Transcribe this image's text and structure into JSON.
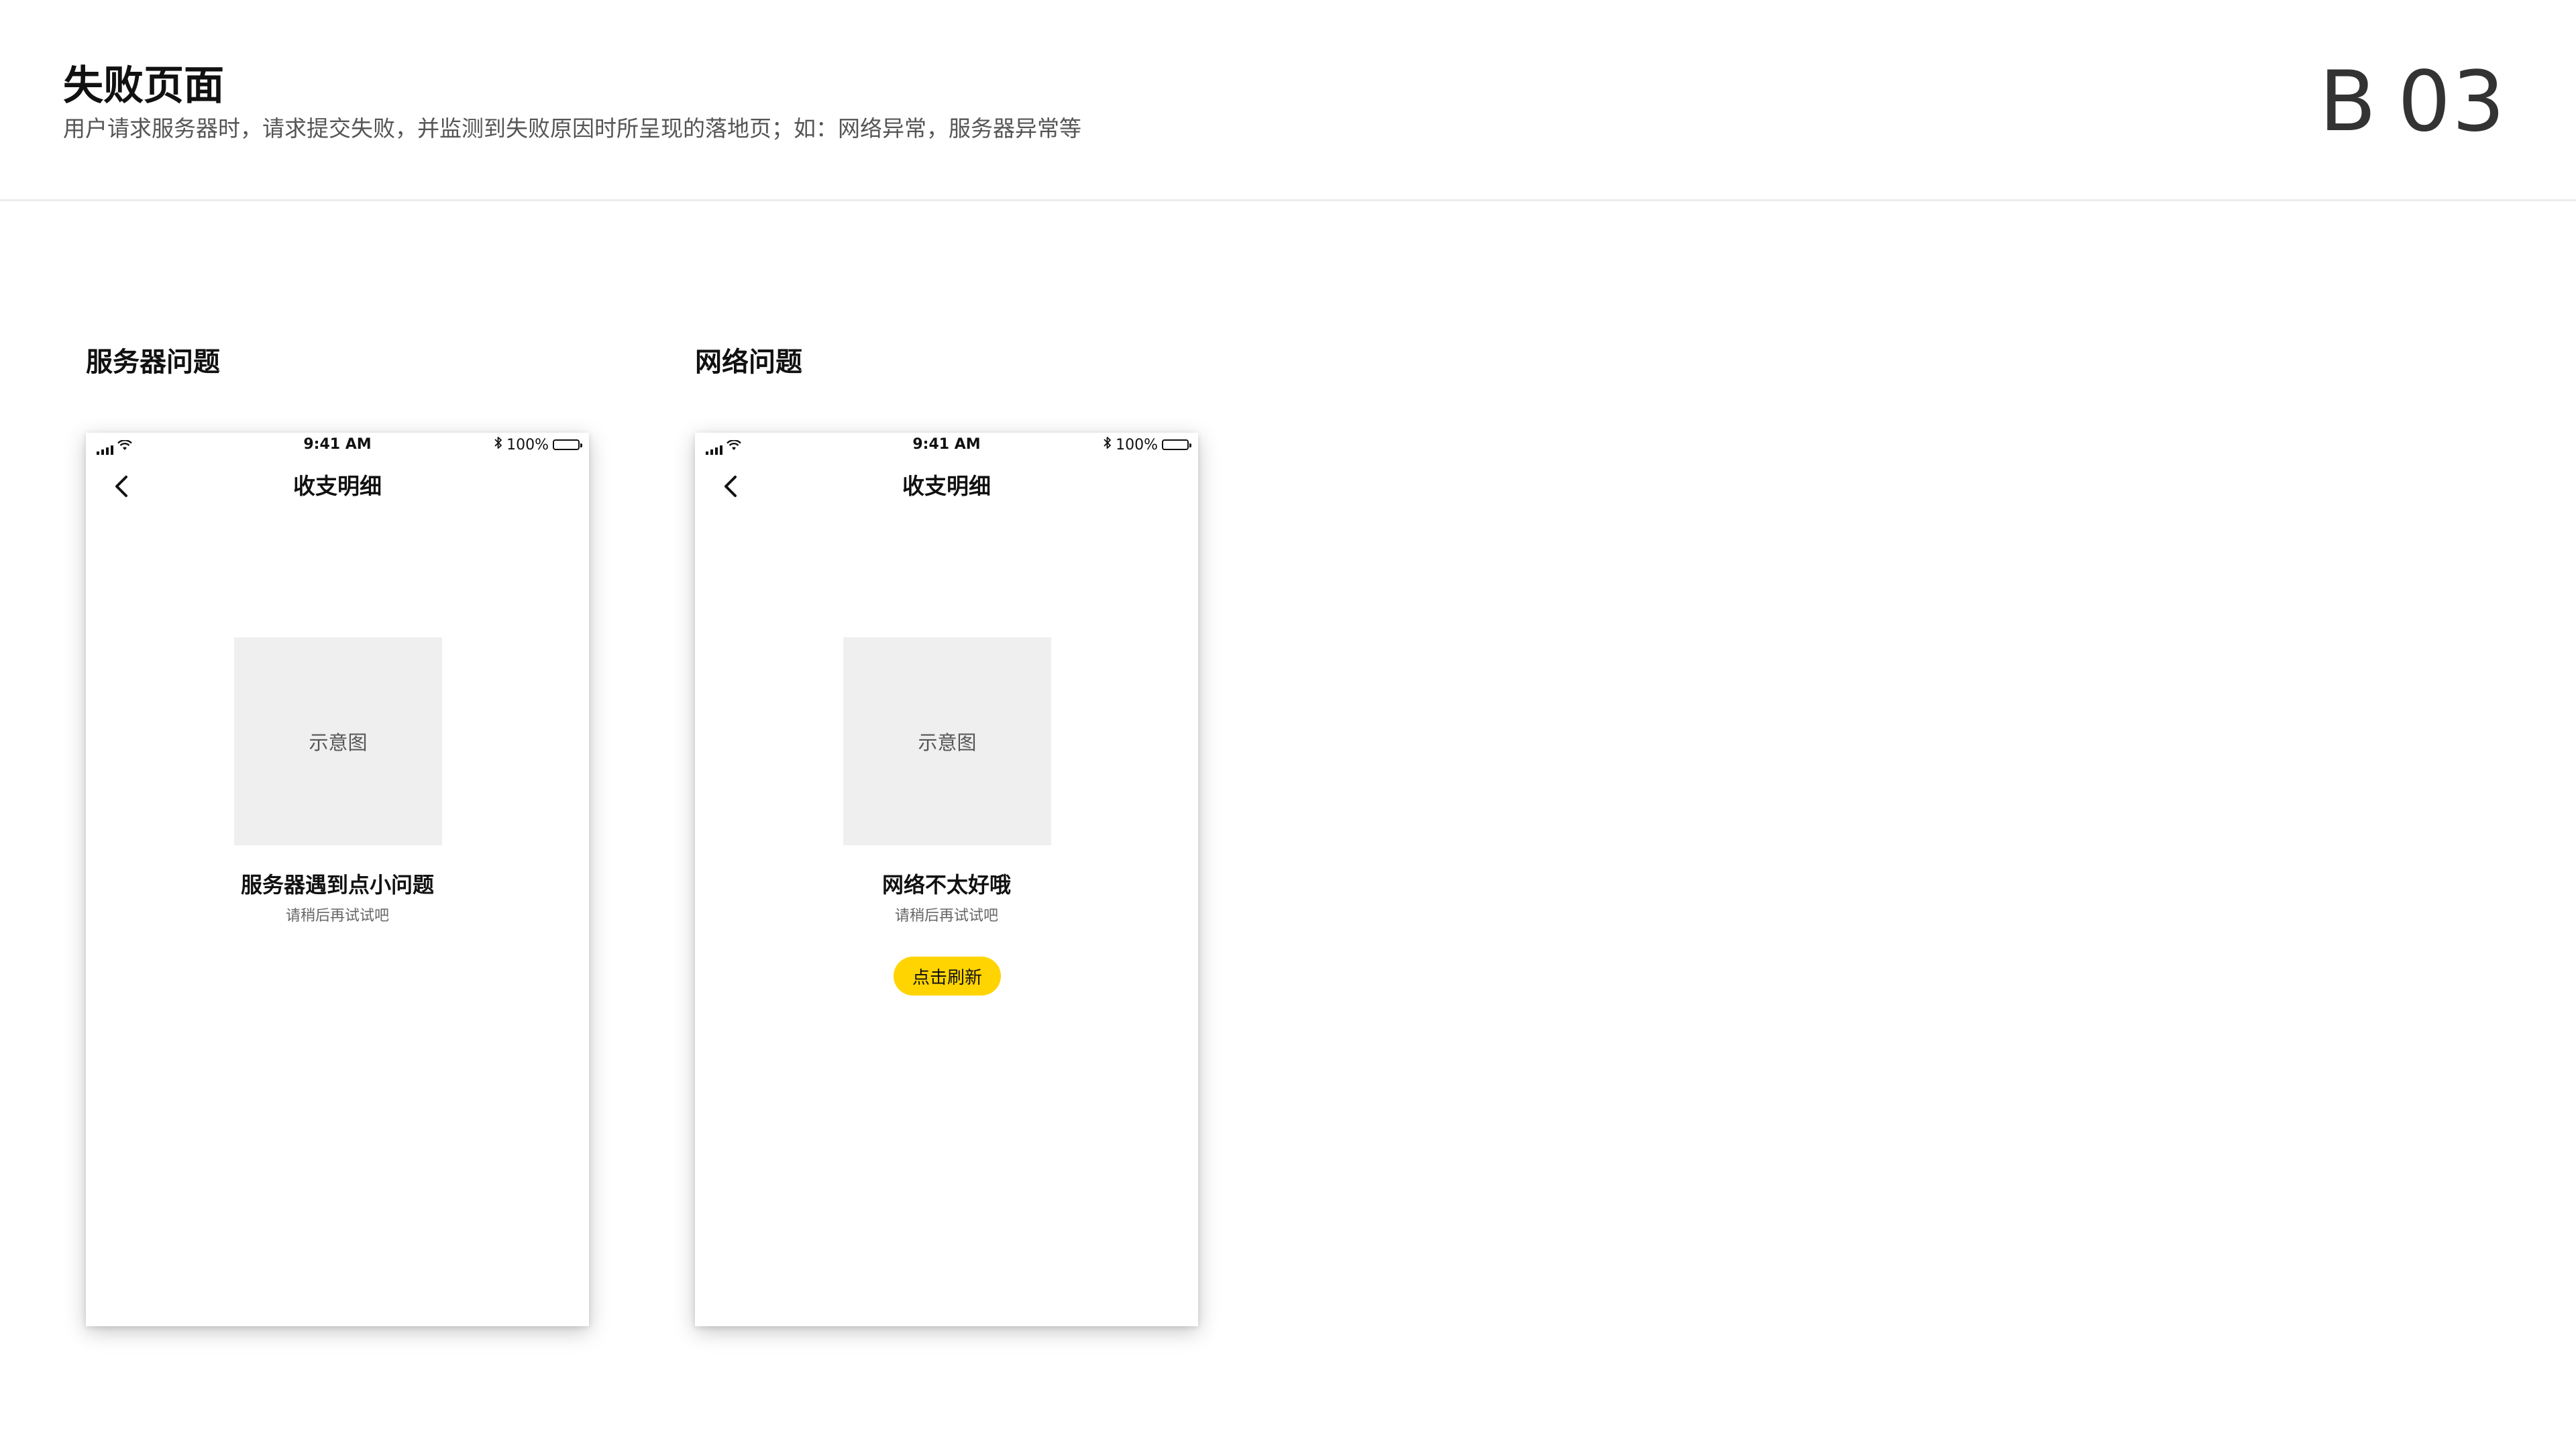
{
  "header": {
    "title": "失败页面",
    "description": "用户请求服务器时，请求提交失败，并监测到失败原因时所呈现的落地页；如：网络异常，服务器异常等",
    "code_letter": "B",
    "code_number": "03"
  },
  "panels": [
    {
      "label": "服务器问题",
      "status": {
        "time": "9:41 AM",
        "battery": "100%"
      },
      "nav_title": "收支明细",
      "placeholder_text": "示意图",
      "state_title": "服务器遇到点小问题",
      "state_subtitle": "请稍后再试试吧"
    },
    {
      "label": "网络问题",
      "status": {
        "time": "9:41 AM",
        "battery": "100%"
      },
      "nav_title": "收支明细",
      "placeholder_text": "示意图",
      "state_title": "网络不太好哦",
      "state_subtitle": "请稍后再试试吧",
      "button_label": "点击刷新"
    }
  ],
  "colors": {
    "accent_button": "#ffd400",
    "placeholder_bg": "#efeff0",
    "text_primary": "#111111",
    "text_secondary": "#555555"
  },
  "icons": [
    "back-chevron-icon",
    "signal-icon",
    "wifi-icon",
    "bluetooth-icon",
    "battery-icon"
  ]
}
